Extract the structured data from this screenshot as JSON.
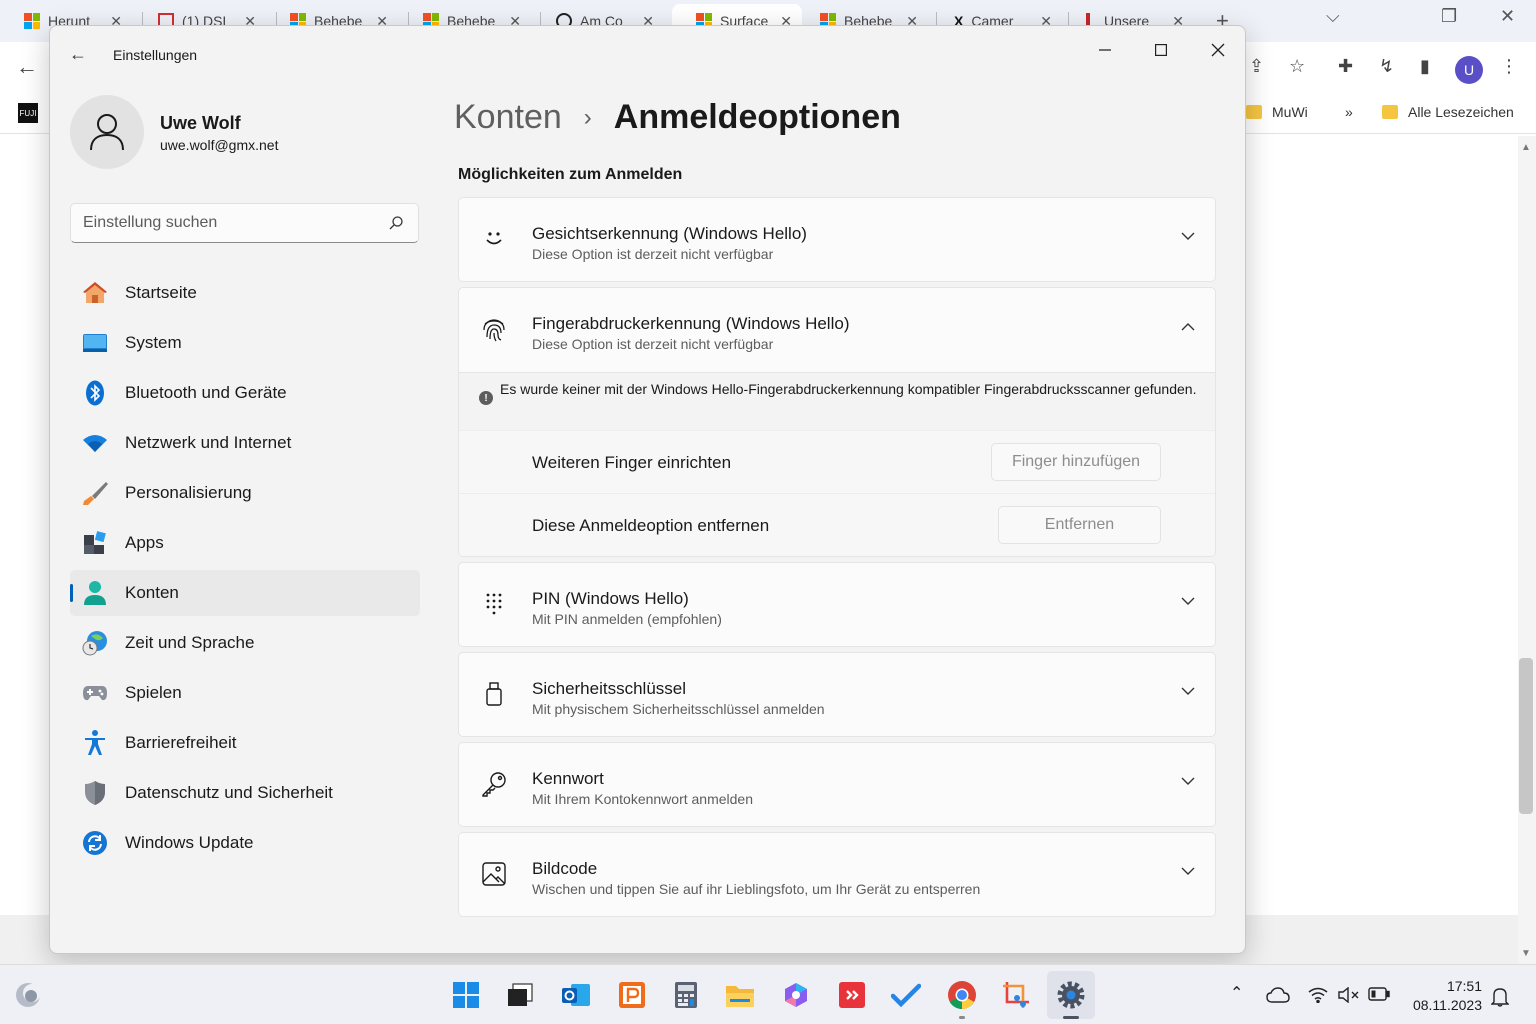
{
  "browser": {
    "tabs": [
      {
        "title": "Herunt",
        "favicon": "windows-logo"
      },
      {
        "title": "(1) DSL",
        "favicon": "dsl-icon"
      },
      {
        "title": "Behebe",
        "favicon": "windows-logo"
      },
      {
        "title": "Behebe",
        "favicon": "windows-logo"
      },
      {
        "title": "Am Co",
        "favicon": "clock-icon"
      },
      {
        "title": "Surface",
        "favicon": "windows-logo"
      },
      {
        "title": "Behebe",
        "favicon": "windows-logo"
      },
      {
        "title": "Camer",
        "favicon": "x-logo"
      },
      {
        "title": "Unsere",
        "favicon": "brand-icon"
      }
    ],
    "close_glyph": "✕",
    "new_tab": "+",
    "minimize": "⌵",
    "restore": "❐",
    "close": "✕",
    "profile_initial": "U",
    "bookmarks": [
      {
        "label": "MuWi"
      },
      {
        "label": "Alle Lesezeichen"
      }
    ],
    "bookmark_overflow": "»",
    "favicon_text": "FUJI"
  },
  "settings": {
    "window_title": "Einstellungen",
    "user": {
      "name": "Uwe Wolf",
      "email": "uwe.wolf@gmx.net"
    },
    "search_placeholder": "Einstellung suchen",
    "nav": [
      {
        "label": "Startseite",
        "icon": "home-icon"
      },
      {
        "label": "System",
        "icon": "system-icon"
      },
      {
        "label": "Bluetooth und Geräte",
        "icon": "bluetooth-icon"
      },
      {
        "label": "Netzwerk und Internet",
        "icon": "wifi-icon"
      },
      {
        "label": "Personalisierung",
        "icon": "brush-icon"
      },
      {
        "label": "Apps",
        "icon": "apps-icon"
      },
      {
        "label": "Konten",
        "icon": "accounts-icon",
        "active": true
      },
      {
        "label": "Zeit und Sprache",
        "icon": "globe-clock-icon"
      },
      {
        "label": "Spielen",
        "icon": "gamepad-icon"
      },
      {
        "label": "Barrierefreiheit",
        "icon": "accessibility-icon"
      },
      {
        "label": "Datenschutz und Sicherheit",
        "icon": "shield-icon"
      },
      {
        "label": "Windows Update",
        "icon": "update-icon"
      }
    ],
    "breadcrumb": {
      "parent": "Konten",
      "separator": "›",
      "current": "Anmeldeoptionen"
    },
    "section_title": "Möglichkeiten zum Anmelden",
    "options": [
      {
        "title": "Gesichtserkennung (Windows Hello)",
        "subtitle": "Diese Option ist derzeit nicht verfügbar",
        "icon": "face-icon",
        "expanded": false
      },
      {
        "title": "Fingerabdruckerkennung (Windows Hello)",
        "subtitle": "Diese Option ist derzeit nicht verfügbar",
        "icon": "fingerprint-icon",
        "expanded": true,
        "info": "Es wurde keiner mit der Windows Hello-Fingerabdruckerkennung kompatibler Fingerabdrucksscanner gefunden.",
        "rows": [
          {
            "label": "Weiteren Finger einrichten",
            "button": "Finger hinzufügen"
          },
          {
            "label": "Diese Anmeldeoption entfernen",
            "button": "Entfernen"
          }
        ]
      },
      {
        "title": "PIN (Windows Hello)",
        "subtitle": "Mit PIN anmelden (empfohlen)",
        "icon": "pin-keypad-icon",
        "expanded": false
      },
      {
        "title": "Sicherheitsschlüssel",
        "subtitle": "Mit physischem Sicherheitsschlüssel anmelden",
        "icon": "usb-key-icon",
        "expanded": false
      },
      {
        "title": "Kennwort",
        "subtitle": "Mit Ihrem Kontokennwort anmelden",
        "icon": "key-icon",
        "expanded": false
      },
      {
        "title": "Bildcode",
        "subtitle": "Wischen und tippen Sie auf ihr Lieblingsfoto, um Ihr Gerät zu entsperren",
        "icon": "picture-icon",
        "expanded": false
      }
    ]
  },
  "taskbar": {
    "apps": [
      "start-icon",
      "task-view-icon",
      "outlook-icon",
      "presentation-app-icon",
      "calculator-icon",
      "file-explorer-icon",
      "copilot-icon",
      "anydesk-icon",
      "todo-icon",
      "chrome-icon",
      "snipping-tool-icon",
      "settings-icon"
    ],
    "time": "17:51",
    "date": "08.11.2023"
  },
  "colors": {
    "accent": "#005fb8",
    "window_bg": "#f3f3f3",
    "card_bg": "#fbfbfb",
    "taskbar_bg": "#eef0f6"
  }
}
